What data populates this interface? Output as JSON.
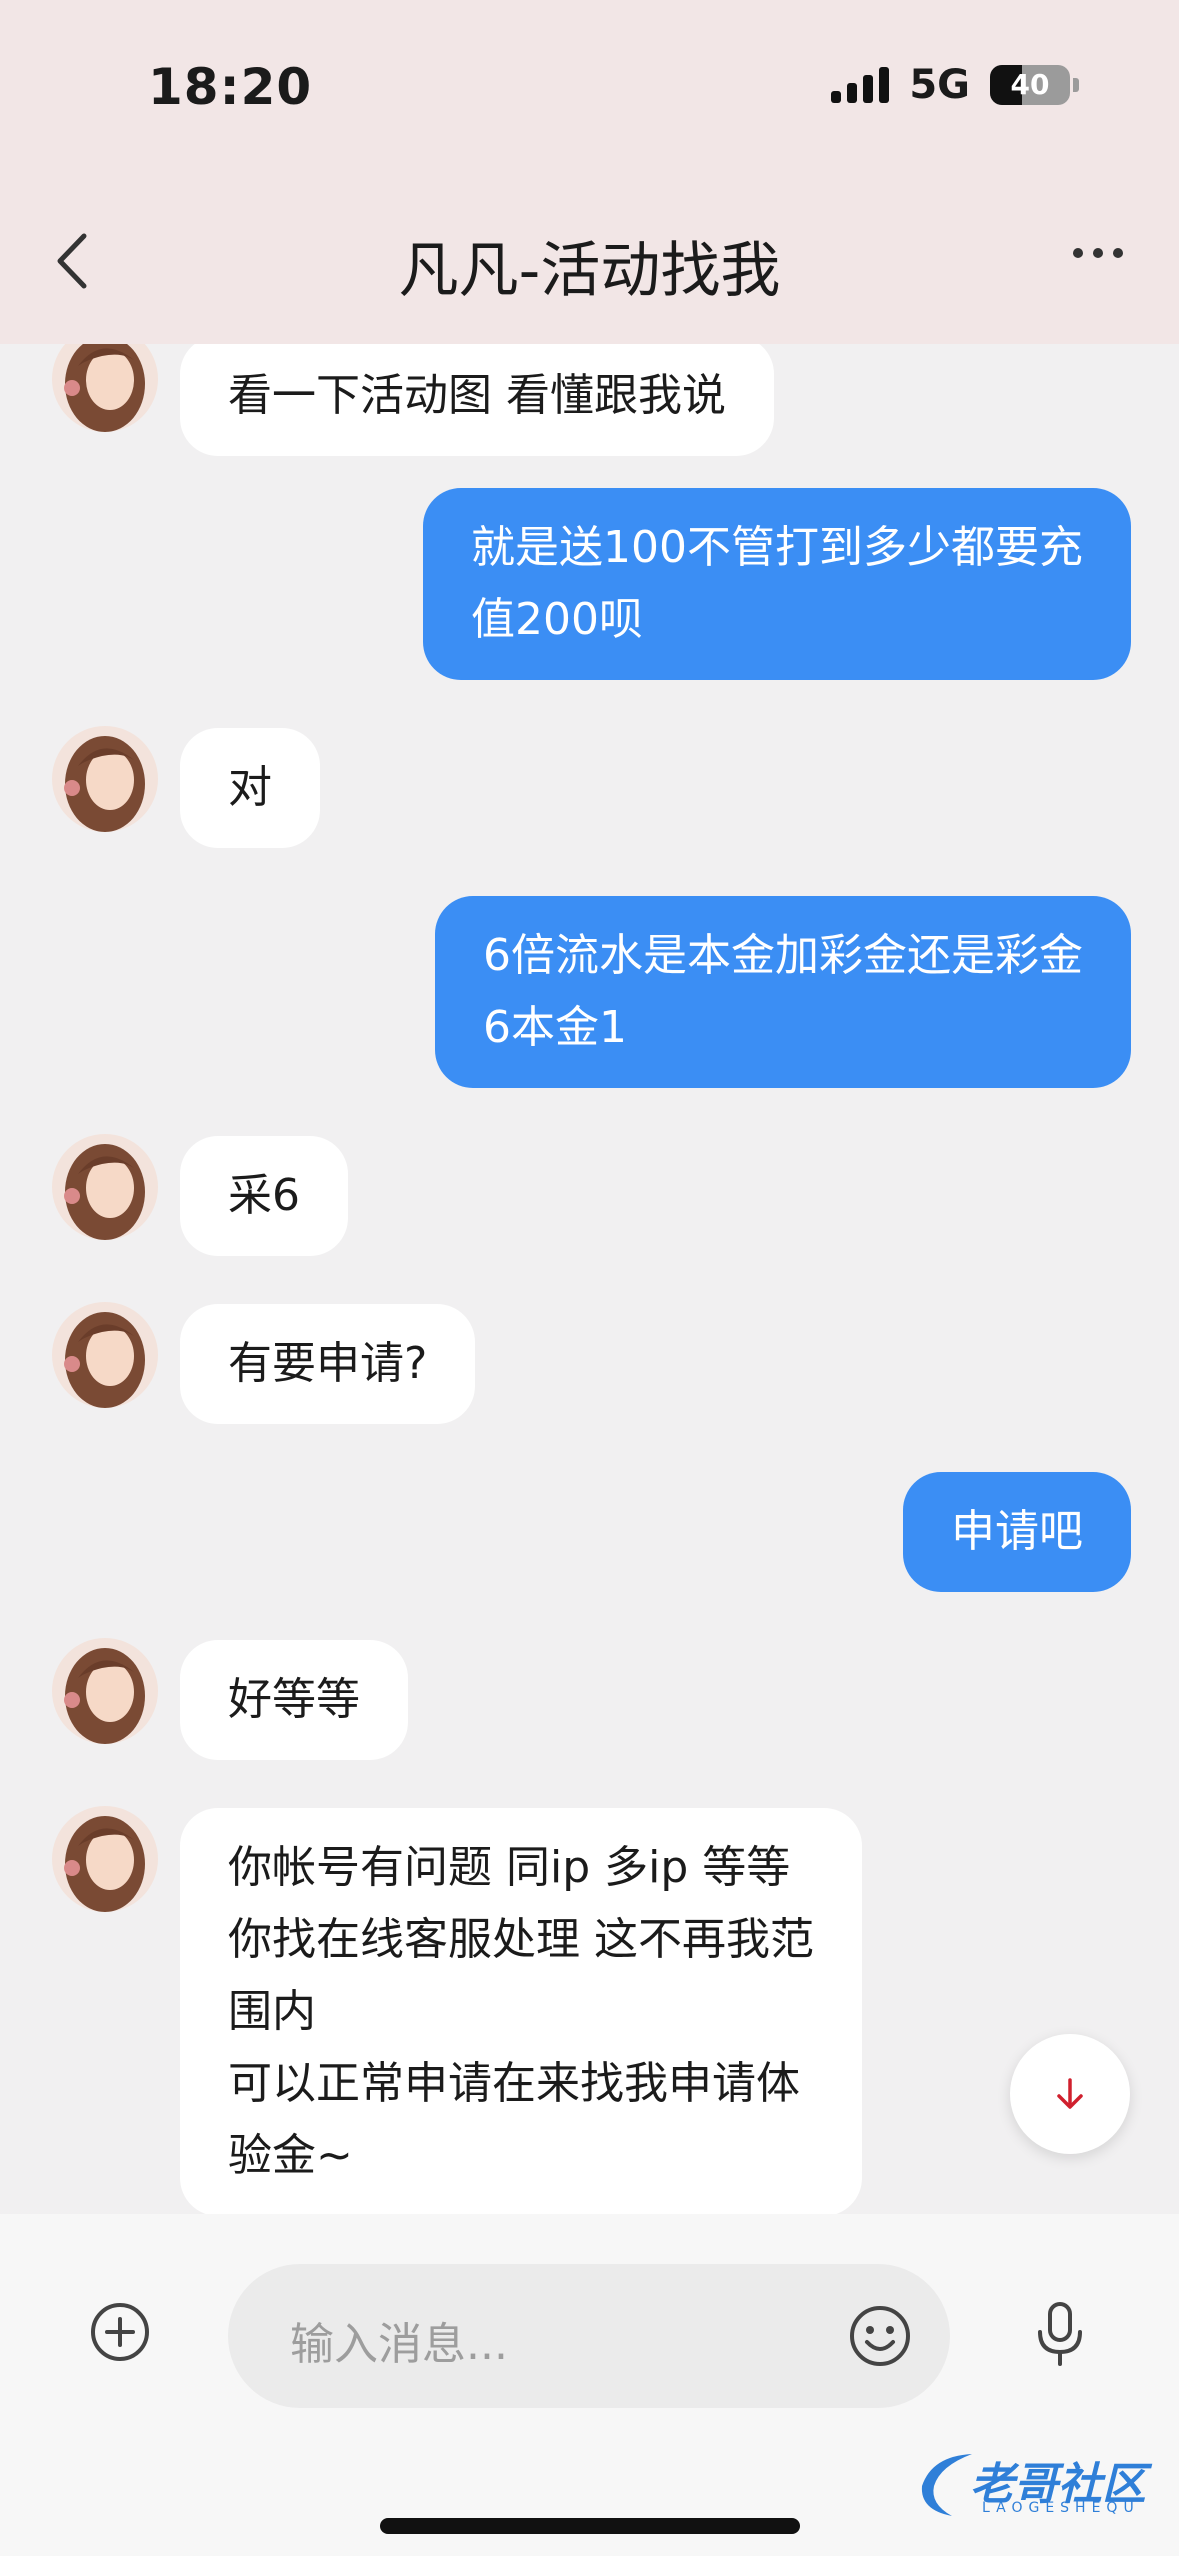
{
  "status_bar": {
    "time": "18:20",
    "network": "5G",
    "battery_level": 40,
    "battery_text": "40"
  },
  "header": {
    "title": "凡凡-活动找我",
    "back_icon": "chevron-left-icon",
    "more_icon": "more-horizontal-icon",
    "background": "#f2e6e6"
  },
  "colors": {
    "outgoing_bubble": "#3b8ef4",
    "incoming_bubble": "#ffffff",
    "chat_background": "#f1f0f1"
  },
  "messages": [
    {
      "from": "them",
      "lines": [
        "看一下活动图 看懂跟我说"
      ]
    },
    {
      "from": "me",
      "lines": [
        "就是送100不管打到多少都要充",
        "值200呗"
      ]
    },
    {
      "from": "them",
      "lines": [
        "对"
      ]
    },
    {
      "from": "me",
      "lines": [
        "6倍流水是本金加彩金还是彩金",
        "6本金1"
      ]
    },
    {
      "from": "them",
      "lines": [
        "采6"
      ]
    },
    {
      "from": "them",
      "lines": [
        "有要申请?"
      ]
    },
    {
      "from": "me",
      "lines": [
        "申请吧"
      ]
    },
    {
      "from": "them",
      "lines": [
        "好等等"
      ]
    },
    {
      "from": "them",
      "lines": [
        "你帐号有问题 同ip 多ip 等等",
        "你找在线客服处理 这不再我范",
        "围内",
        "可以正常申请在来找我申请体",
        "验金~"
      ]
    }
  ],
  "composer": {
    "placeholder": "输入消息...",
    "add_icon": "plus-circle-icon",
    "emoji_icon": "smiley-icon",
    "mic_icon": "microphone-icon"
  },
  "scroll_down_icon": "arrow-down-icon",
  "watermark": {
    "text": "老哥社区",
    "subtext": "LAOGESHEQU"
  }
}
